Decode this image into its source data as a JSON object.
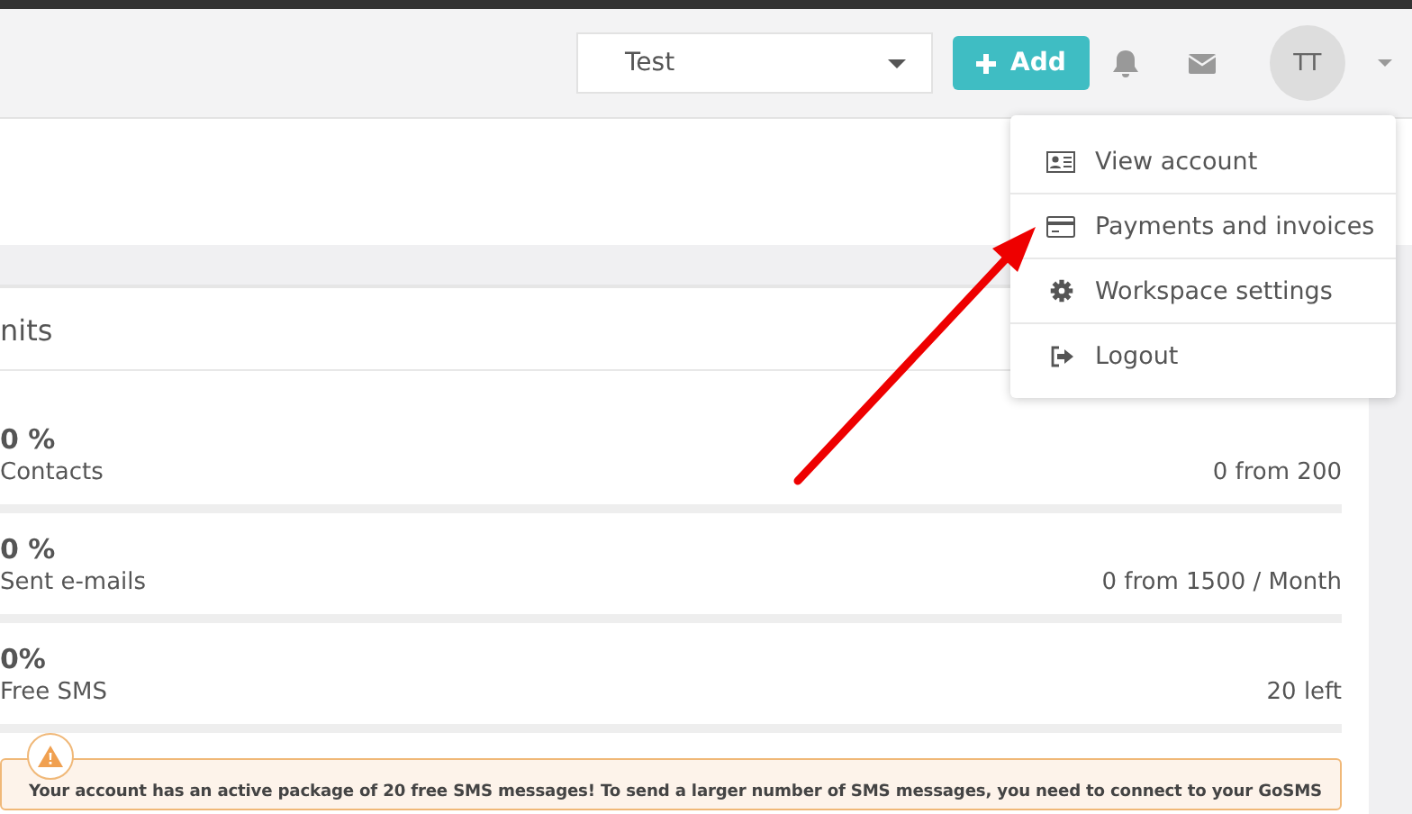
{
  "header": {
    "workspace_select": {
      "value": "Test"
    },
    "add_button": {
      "label": "Add"
    },
    "avatar": {
      "initials": "TT"
    }
  },
  "user_menu": {
    "items": [
      {
        "kind": "account",
        "label": "View account"
      },
      {
        "kind": "card",
        "label": "Payments and invoices"
      },
      {
        "kind": "gear",
        "label": "Workspace settings"
      },
      {
        "kind": "logout",
        "label": "Logout"
      }
    ]
  },
  "limits": {
    "title": "nits",
    "rows": [
      {
        "percent": "0 %",
        "name": "Contacts",
        "usage": "0 from 200",
        "level": 0
      },
      {
        "percent": "0 %",
        "name": "Sent e-mails",
        "usage": "0 from 1500 / Month",
        "level": 0
      },
      {
        "percent": "0%",
        "name": "Free SMS",
        "usage": "20 left",
        "level": 0
      }
    ]
  },
  "alert": {
    "text": "Your account has an active package of 20 free SMS messages! To send a larger number of SMS messages, you need to connect to your GoSMS"
  }
}
